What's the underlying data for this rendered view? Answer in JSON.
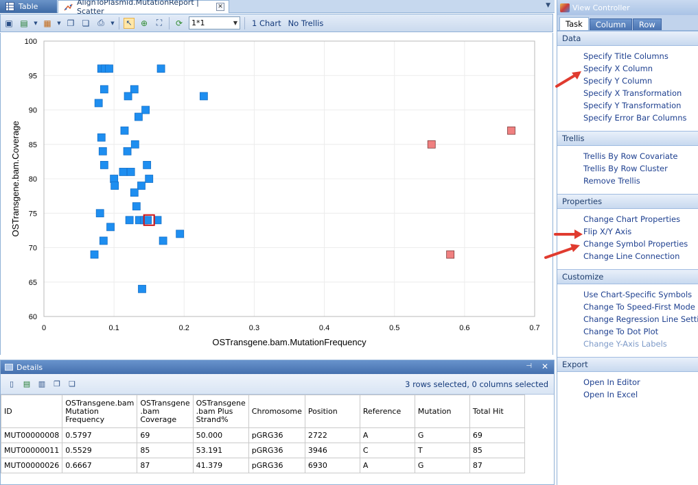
{
  "tabs": {
    "table_label": "Table",
    "scatter_label": "AlignToPlasmid.MutationReport | Scatter",
    "close_glyph": "✕"
  },
  "toolbar": {
    "layout_value": "1*1",
    "chart_count": "1 Chart",
    "trellis_label": "No Trellis"
  },
  "chart_data": {
    "type": "scatter",
    "xlabel": "OSTransgene.bam.MutationFrequency",
    "ylabel": "OSTransgene.bam.Coverage",
    "xlim": [
      0,
      0.7
    ],
    "ylim": [
      60,
      100
    ],
    "x_ticks": [
      "0",
      "0.1",
      "0.2",
      "0.3",
      "0.4",
      "0.5",
      "0.6",
      "0.7"
    ],
    "y_ticks": [
      "60",
      "65",
      "70",
      "75",
      "80",
      "85",
      "90",
      "95",
      "100"
    ],
    "grid": true,
    "colors": {
      "normal": "#1e8ef0",
      "selected": "#f08080",
      "highlight_border": "#d01414"
    },
    "series": [
      {
        "values": [
          [
            0.082,
            96
          ],
          [
            0.087,
            96
          ],
          [
            0.093,
            96
          ],
          [
            0.167,
            96
          ],
          [
            0.086,
            93
          ],
          [
            0.129,
            93
          ],
          [
            0.078,
            91
          ],
          [
            0.12,
            92
          ],
          [
            0.228,
            92
          ],
          [
            0.145,
            90
          ],
          [
            0.135,
            89
          ],
          [
            0.115,
            87
          ],
          [
            0.082,
            86
          ],
          [
            0.084,
            84
          ],
          [
            0.119,
            84
          ],
          [
            0.13,
            85
          ],
          [
            0.086,
            82
          ],
          [
            0.147,
            82
          ],
          [
            0.1,
            80
          ],
          [
            0.113,
            81
          ],
          [
            0.124,
            81
          ],
          [
            0.15,
            80
          ],
          [
            0.101,
            79
          ],
          [
            0.139,
            79
          ],
          [
            0.129,
            78
          ],
          [
            0.132,
            76
          ],
          [
            0.08,
            75
          ],
          [
            0.122,
            74
          ],
          [
            0.136,
            74
          ],
          [
            0.143,
            74
          ],
          [
            0.148,
            74
          ],
          [
            0.162,
            74
          ],
          [
            0.095,
            73
          ],
          [
            0.194,
            72
          ],
          [
            0.085,
            71
          ],
          [
            0.17,
            71
          ],
          [
            0.072,
            69
          ],
          [
            0.14,
            64
          ]
        ]
      },
      {
        "values": [
          [
            0.5797,
            69
          ],
          [
            0.5529,
            85
          ],
          [
            0.6667,
            87
          ]
        ]
      }
    ],
    "highlighted": [
      0.15,
      74
    ]
  },
  "details": {
    "title": "Details",
    "pin_glyph": "⊣",
    "close_glyph": "✕",
    "status": "3 rows selected, 0 columns selected",
    "headers": [
      "ID",
      "OSTransgene.bam Mutation Frequency",
      "OSTransgene .bam Coverage",
      "OSTransgene .bam Plus Strand%",
      "Chromosome",
      "Position",
      "Reference",
      "Mutation",
      "Total Hit"
    ],
    "rows": [
      [
        "MUT00000008",
        "0.5797",
        "69",
        "50.000",
        "pGRG36",
        "2722",
        "A",
        "G",
        "69"
      ],
      [
        "MUT00000011",
        "0.5529",
        "85",
        "53.191",
        "pGRG36",
        "3946",
        "C",
        "T",
        "85"
      ],
      [
        "MUT00000026",
        "0.6667",
        "87",
        "41.379",
        "pGRG36",
        "6930",
        "A",
        "G",
        "87"
      ]
    ]
  },
  "view_controller": {
    "title": "View Controller",
    "tabs": [
      "Task",
      "Column",
      "Row"
    ],
    "sections": [
      {
        "name": "Data",
        "items": [
          "Specify Title Columns",
          "Specify X Column",
          "Specify Y Column",
          "Specify X Transformation",
          "Specify Y Transformation",
          "Specify Error Bar Columns"
        ]
      },
      {
        "name": "Trellis",
        "items": [
          "Trellis By Row Covariate",
          "Trellis By Row Cluster",
          "Remove Trellis"
        ]
      },
      {
        "name": "Properties",
        "items": [
          "Change Chart Properties",
          "Flip X/Y Axis",
          "Change Symbol Properties",
          "Change Line Connection"
        ]
      },
      {
        "name": "Customize",
        "items": [
          "Use Chart-Specific Symbols",
          "Change To Speed-First Mode",
          "Change Regression Line Setting",
          "Change To Dot Plot",
          "Change Y-Axis Labels"
        ]
      },
      {
        "name": "Export",
        "items": [
          "Open In Editor",
          "Open In Excel"
        ]
      }
    ]
  }
}
